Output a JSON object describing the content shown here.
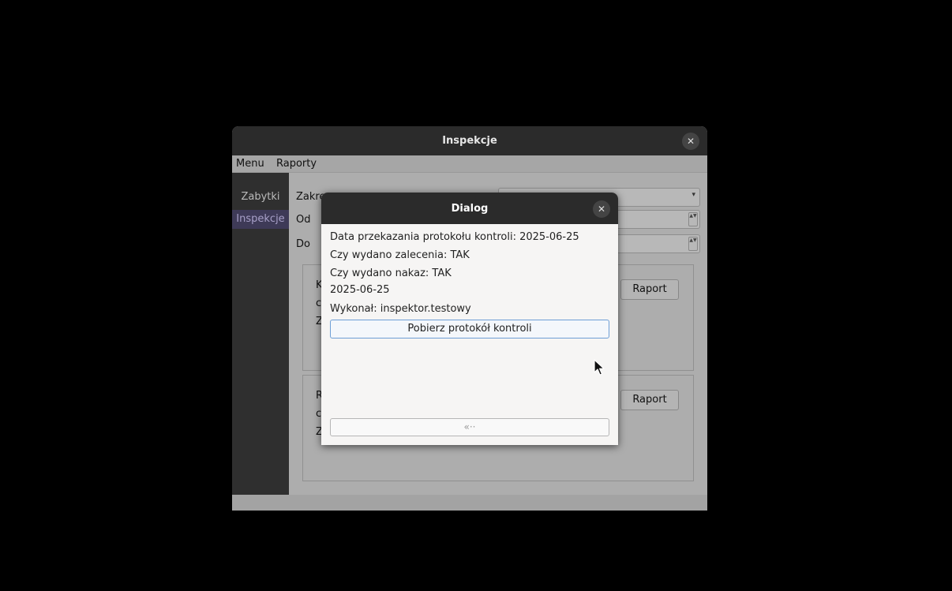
{
  "window": {
    "title": "Inspekcje",
    "menu": [
      "Menu",
      "Raporty"
    ],
    "sidebar": [
      {
        "label": "Zabytki",
        "selected": false
      },
      {
        "label": "Inspekcje",
        "selected": true
      }
    ],
    "filters": {
      "scope_label": "Zakre",
      "from_label": "Od",
      "to_label": "Do"
    },
    "groups": [
      {
        "letters": [
          "K",
          "c",
          "Z"
        ],
        "button": "Raport"
      },
      {
        "letters": [
          "R",
          "c",
          "Z"
        ],
        "button": "Raport"
      }
    ]
  },
  "dialog": {
    "title": "Dialog",
    "lines": [
      "Data przekazania protokołu kontroli: 2025-06-25",
      "Czy wydano zalecenia: TAK",
      "Czy wydano nakaz: TAK",
      "2025-06-25",
      "Wykonał: inspektor.testowy"
    ],
    "download_button": "Pobierz protokół kontroli",
    "back_icon": "«··"
  },
  "icons": {
    "close": "✕",
    "dropdown": "▾",
    "spin": "▲▼",
    "cursor": "arrow-cursor"
  },
  "colors": {
    "titlebar": "#2b2b2b",
    "sidebar_selected": "#3e3a57",
    "dialog_bg": "#f6f5f4",
    "button_focus_border": "#6e9fd6"
  }
}
